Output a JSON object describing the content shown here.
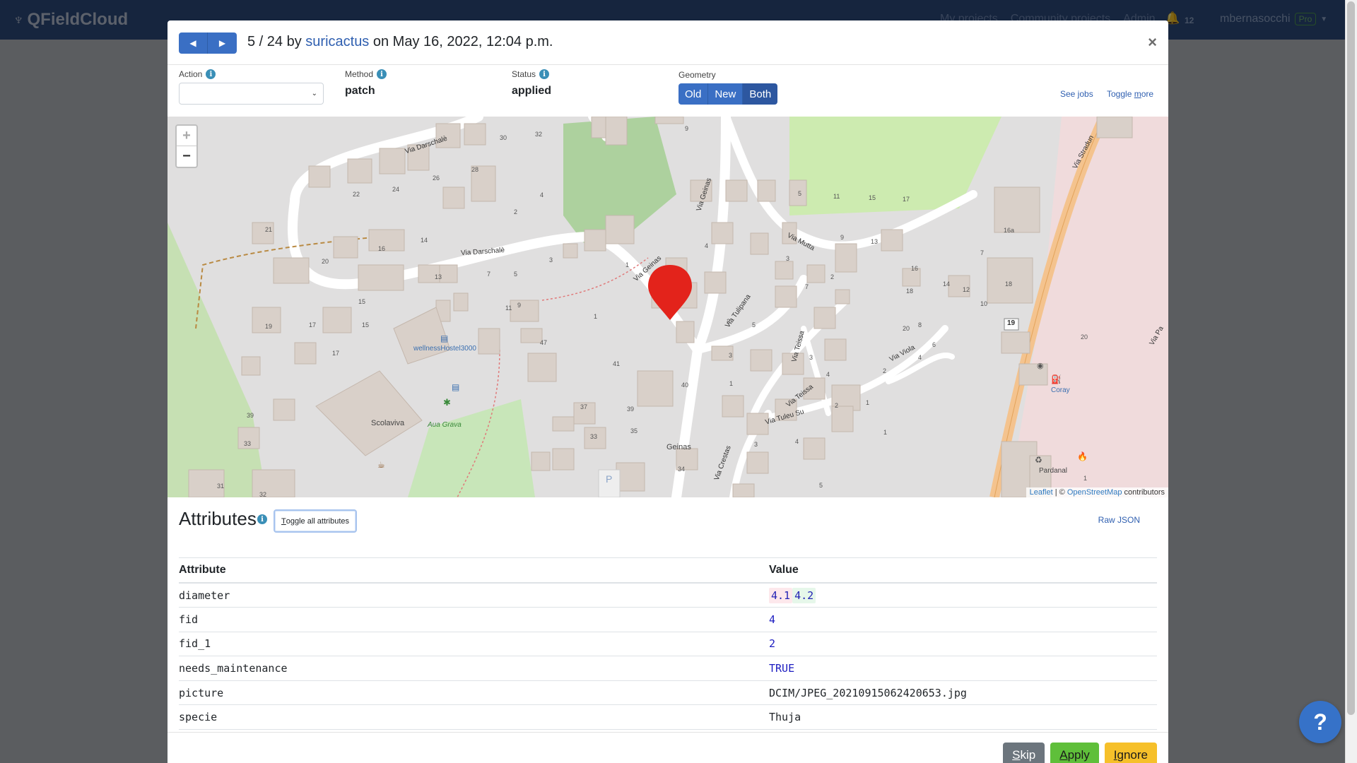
{
  "navbar": {
    "brand": "QFieldCloud",
    "links": [
      "My projects",
      "Community projects",
      "Admin"
    ],
    "notification_count": "12",
    "username": "mbernasocchi",
    "plan_badge": "Pro"
  },
  "modal": {
    "title_prefix": "5 / 24 by ",
    "title_user": "suricactus",
    "title_suffix": " on May 16, 2022, 12:04 p.m.",
    "close_symbol": "×",
    "action_label": "Action",
    "action_value": "",
    "method_label": "Method",
    "method_value": "patch",
    "status_label": "Status",
    "status_value": "applied",
    "geometry_label": "Geometry",
    "geometry_options": [
      "Old",
      "New",
      "Both"
    ],
    "geometry_selected": "Both",
    "see_jobs": "See jobs",
    "toggle_more_prefix": "Toggle ",
    "toggle_more_u": "m",
    "toggle_more_suffix": "ore"
  },
  "map": {
    "zoom_in": "+",
    "zoom_out": "−",
    "attribution_leaflet": "Leaflet",
    "attribution_sep": " | © ",
    "attribution_osm": "OpenStreetMap",
    "attribution_suffix": " contributors",
    "street_labels": [
      "Via Darschalè",
      "Via Darschalè",
      "Via Geinas",
      "Via Geinas",
      "Via Mutta",
      "Via Tulipana",
      "Via Teissa",
      "Via Teissa",
      "Via Viola",
      "Via Tuleu Su",
      "Via Crestas",
      "Via Stradun",
      "Via Pa"
    ],
    "poi_labels": [
      "wellnessHostel3000",
      "Scolaviva",
      "Aua Grava",
      "Geinas",
      "Coray",
      "Pardanal"
    ],
    "house_numbers": [
      "30",
      "32",
      "9",
      "22",
      "24",
      "26",
      "28",
      "2",
      "4",
      "21",
      "16",
      "14",
      "20",
      "13",
      "7",
      "5",
      "3",
      "1",
      "11",
      "9",
      "15",
      "17",
      "4",
      "5",
      "11",
      "15",
      "17",
      "9",
      "13",
      "3",
      "2",
      "7",
      "16",
      "14",
      "12",
      "18",
      "10",
      "19",
      "15",
      "17",
      "47",
      "1",
      "41",
      "40",
      "2",
      "5",
      "3",
      "1",
      "3",
      "20",
      "8",
      "6",
      "4",
      "2",
      "1",
      "4",
      "39",
      "33",
      "37",
      "39",
      "35",
      "33",
      "34",
      "3",
      "2",
      "5",
      "4",
      "1",
      "7",
      "18",
      "16a",
      "20",
      "1",
      "31",
      "32"
    ],
    "route_badge": "19",
    "parking": "P"
  },
  "attributes": {
    "title": "Attributes",
    "toggle_all_prefix": "T",
    "toggle_all_rest": "oggle all attributes",
    "raw_json": "Raw JSON",
    "col_attribute": "Attribute",
    "col_value": "Value",
    "rows": [
      {
        "name": "diameter",
        "old": "4.1",
        "new": "4.2"
      },
      {
        "name": "fid",
        "value": "4"
      },
      {
        "name": "fid_1",
        "value": "2"
      },
      {
        "name": "needs_maintenance",
        "value": "TRUE"
      },
      {
        "name": "picture",
        "value": "DCIM/JPEG_20210915062420653.jpg"
      },
      {
        "name": "specie",
        "value": "Thuja"
      }
    ]
  },
  "footer": {
    "skip_u": "S",
    "skip_rest": "kip",
    "apply_u": "A",
    "apply_rest": "pply",
    "ignore_u": "I",
    "ignore_rest": "gnore"
  },
  "help_button": "?",
  "colors": {
    "primary": "#3a6fc4",
    "link": "#2f5fb0",
    "marker": "#e3231b",
    "apply": "#5fbf3a",
    "ignore": "#f6c02a",
    "skip": "#6c757d"
  }
}
